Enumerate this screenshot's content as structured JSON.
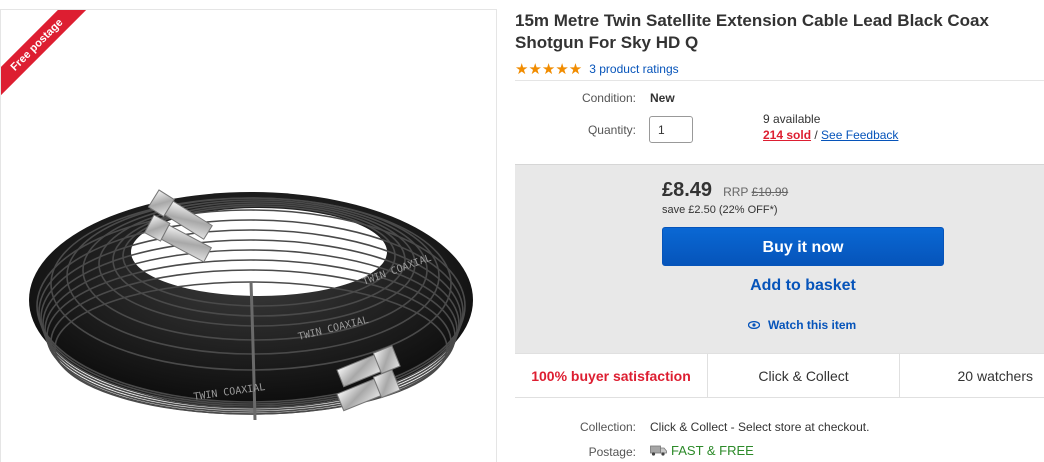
{
  "listing": {
    "ribbon": "Free postage",
    "title": "15m Metre Twin Satellite Extension Cable Lead Black Coax Shotgun For Sky HD Q",
    "stars": "★★★★★",
    "ratings_text": "3 product ratings",
    "condition_label": "Condition:",
    "condition_value": "New",
    "quantity_label": "Quantity:",
    "quantity_value": "1",
    "available": "9 available",
    "sold": "214 sold",
    "sold_separator": " / ",
    "feedback": "See Feedback"
  },
  "purchase": {
    "price": "£8.49",
    "rrp_label": "RRP",
    "rrp_value": "£10.99",
    "save": "save £2.50 (22% OFF*)",
    "buy_now": "Buy it now",
    "add_basket": "Add to basket",
    "watch": "Watch this item"
  },
  "stats": {
    "satisfaction": "100% buyer satisfaction",
    "collect": "Click & Collect",
    "watchers": "20 watchers"
  },
  "delivery": {
    "collection_label": "Collection:",
    "collection_value": "Click & Collect - Select store at checkout.",
    "postage_label": "Postage:",
    "postage_value": "FAST & FREE"
  },
  "colors": {
    "accent_blue": "#0654ba",
    "star_orange": "#f18c00",
    "ribbon_red": "#dd1e31",
    "free_green": "#2c8a29"
  },
  "icons": [
    "eye-icon",
    "truck-icon",
    "star-icon"
  ]
}
